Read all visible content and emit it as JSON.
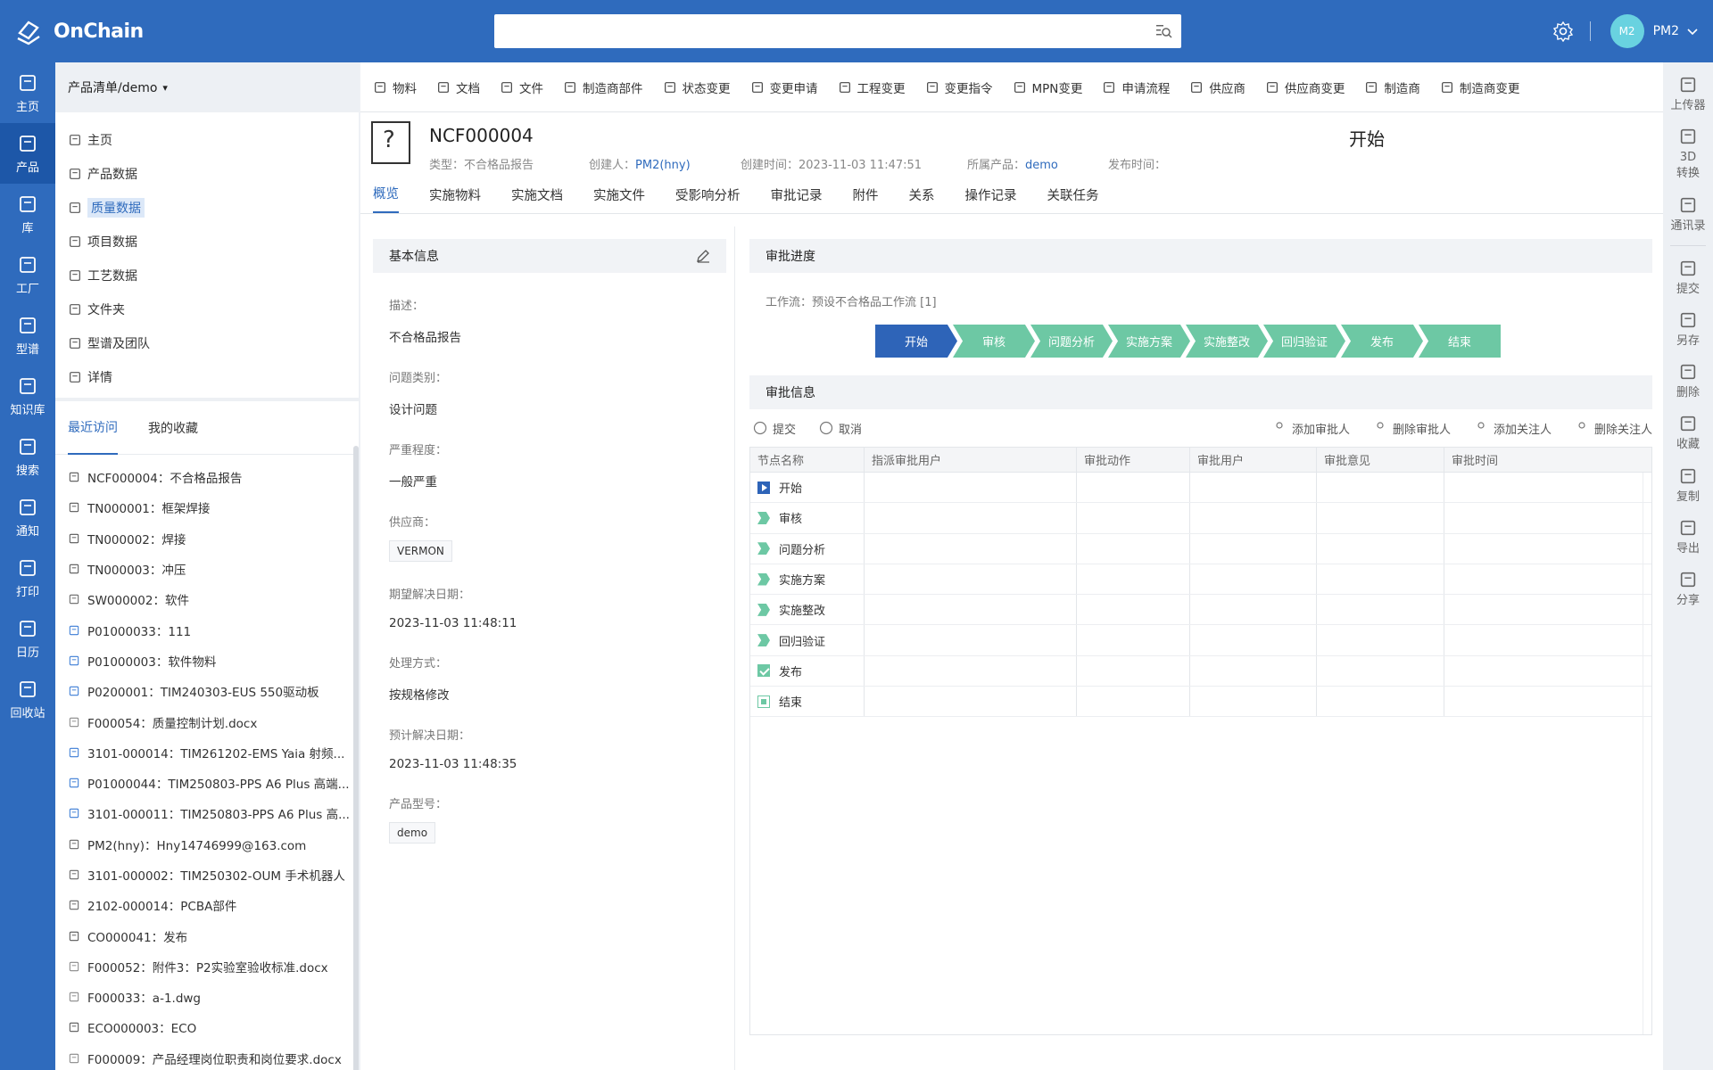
{
  "app": {
    "logo": "OnChain"
  },
  "search": {
    "placeholder": ""
  },
  "user": {
    "avatar": "M2",
    "name": "PM2"
  },
  "leftnav": [
    {
      "label": "主页",
      "icon": "home-icon"
    },
    {
      "label": "产品",
      "icon": "product-icon"
    },
    {
      "label": "库",
      "icon": "library-icon"
    },
    {
      "label": "工厂",
      "icon": "factory-icon"
    },
    {
      "label": "型谱",
      "icon": "spectrum-icon"
    },
    {
      "label": "知识库",
      "icon": "knowledge-icon"
    },
    {
      "label": "搜索",
      "icon": "search-doc-icon"
    },
    {
      "label": "通知",
      "icon": "mail-icon"
    },
    {
      "label": "打印",
      "icon": "print-icon"
    },
    {
      "label": "日历",
      "icon": "calendar-icon"
    },
    {
      "label": "回收站",
      "icon": "trash-icon"
    }
  ],
  "tree": {
    "header": "产品清单/demo",
    "items": [
      {
        "label": "主页",
        "icon": "monitor-icon"
      },
      {
        "label": "产品数据",
        "icon": "grid-icon"
      },
      {
        "label": "质量数据",
        "icon": "database-icon"
      },
      {
        "label": "项目数据",
        "icon": "bar-chart-icon"
      },
      {
        "label": "工艺数据",
        "icon": "flow-icon"
      },
      {
        "label": "文件夹",
        "icon": "folder-icon"
      },
      {
        "label": "型谱及团队",
        "icon": "tree-icon"
      },
      {
        "label": "详情",
        "icon": "list-icon"
      }
    ],
    "selected": "质量数据",
    "tabs": [
      "最近访问",
      "我的收藏"
    ],
    "recent": [
      {
        "label": "NCF000004：不合格品报告",
        "icon": "doc-icon"
      },
      {
        "label": "TN000001：框架焊接",
        "icon": "process-icon"
      },
      {
        "label": "TN000002：焊接",
        "icon": "process-icon"
      },
      {
        "label": "TN000003：冲压",
        "icon": "process-icon"
      },
      {
        "label": "SW000002：软件",
        "icon": "box-icon"
      },
      {
        "label": "P01000033：111",
        "icon": "cube-icon"
      },
      {
        "label": "P01000003：软件物料",
        "icon": "cube-icon"
      },
      {
        "label": "P0200001：TIM240303-EUS 550驱动板",
        "icon": "cube-icon"
      },
      {
        "label": "F000054：质量控制计划.docx",
        "icon": "file-icon"
      },
      {
        "label": "3101-000014：TIM261202-EMS Yaia 射频...",
        "icon": "cube-icon"
      },
      {
        "label": "P01000044：TIM250803-PPS A6 Plus 高端...",
        "icon": "cube-icon"
      },
      {
        "label": "3101-000011：TIM250803-PPS A6 Plus 高...",
        "icon": "cube-icon"
      },
      {
        "label": "PM2(hny)：Hny14746999@163.com",
        "icon": "user-icon"
      },
      {
        "label": "3101-000002：TIM250302-OUM 手术机器人",
        "icon": "box-icon"
      },
      {
        "label": "2102-000014：PCBA部件",
        "icon": "box-icon"
      },
      {
        "label": "CO000041：发布",
        "icon": "doc-icon"
      },
      {
        "label": "F000052：附件3：P2实验室验收标准.docx",
        "icon": "file-icon"
      },
      {
        "label": "F000033：a-1.dwg",
        "icon": "file-icon"
      },
      {
        "label": "ECO000003：ECO",
        "icon": "doc-icon"
      },
      {
        "label": "F000009：产品经理岗位职责和岗位要求.docx",
        "icon": "file-icon"
      }
    ]
  },
  "toolbar": [
    {
      "label": "物料",
      "icon": "cube-icon"
    },
    {
      "label": "文档",
      "icon": "doc-icon"
    },
    {
      "label": "文件",
      "icon": "file-icon"
    },
    {
      "label": "制造商部件",
      "icon": "building-icon"
    },
    {
      "label": "状态变更",
      "icon": "state-icon"
    },
    {
      "label": "变更申请",
      "icon": "doc-icon"
    },
    {
      "label": "工程变更",
      "icon": "doc-icon"
    },
    {
      "label": "变更指令",
      "icon": "doc-icon"
    },
    {
      "label": "MPN变更",
      "icon": "doc-icon"
    },
    {
      "label": "申请流程",
      "icon": "doc-plus-icon"
    },
    {
      "label": "供应商",
      "icon": "truck-icon"
    },
    {
      "label": "供应商变更",
      "icon": "truck-icon"
    },
    {
      "label": "制造商",
      "icon": "building-icon"
    },
    {
      "label": "制造商变更",
      "icon": "building-icon"
    }
  ],
  "record": {
    "title": "NCF000004",
    "type": "类型：不合格品报告",
    "creator_prefix": "创建人：",
    "creator": "PM2(hny)",
    "created": "创建时间：2023-11-03 11:47:51",
    "product_prefix": "所属产品：",
    "product": "demo",
    "published": "发布时间：",
    "state": "开始"
  },
  "tabs": [
    "概览",
    "实施物料",
    "实施文档",
    "实施文件",
    "受影响分析",
    "审批记录",
    "附件",
    "关系",
    "操作记录",
    "关联任务"
  ],
  "basic": {
    "title": "基本信息",
    "fields": [
      {
        "label": "描述：",
        "value": "不合格品报告"
      },
      {
        "label": "问题类别：",
        "value": "设计问题"
      },
      {
        "label": "严重程度：",
        "value": "一般严重"
      },
      {
        "label": "供应商：",
        "value": "VERMON",
        "tag": true
      },
      {
        "label": "期望解决日期：",
        "value": "2023-11-03 11:48:11"
      },
      {
        "label": "处理方式：",
        "value": "按规格修改"
      },
      {
        "label": "预计解决日期：",
        "value": "2023-11-03 11:48:35"
      },
      {
        "label": "产品型号：",
        "value": "demo",
        "tag": true
      }
    ]
  },
  "progress": {
    "title": "审批进度",
    "workflow": "工作流：预设不合格品工作流 [1]",
    "steps": [
      "开始",
      "审核",
      "问题分析",
      "实施方案",
      "实施整改",
      "回归验证",
      "发布",
      "结束"
    ]
  },
  "approval": {
    "title": "审批信息",
    "actions_left": [
      {
        "label": "提交",
        "icon": "up-circle-icon"
      },
      {
        "label": "取消",
        "icon": "x-circle-icon"
      }
    ],
    "actions_right": [
      {
        "label": "添加审批人",
        "icon": "user-icon"
      },
      {
        "label": "删除审批人",
        "icon": "user-icon"
      },
      {
        "label": "添加关注人",
        "icon": "user-icon"
      },
      {
        "label": "删除关注人",
        "icon": "user-icon"
      }
    ],
    "columns": [
      "节点名称",
      "指派审批用户",
      "审批动作",
      "审批用户",
      "审批意见",
      "审批时间"
    ],
    "rows": [
      {
        "node": "开始",
        "icon": "play"
      },
      {
        "node": "审核",
        "icon": "chevg"
      },
      {
        "node": "问题分析",
        "icon": "chevg"
      },
      {
        "node": "实施方案",
        "icon": "chevg"
      },
      {
        "node": "实施整改",
        "icon": "chevg"
      },
      {
        "node": "回归验证",
        "icon": "chevg"
      },
      {
        "node": "发布",
        "icon": "check"
      },
      {
        "node": "结束",
        "icon": "endsq"
      }
    ]
  },
  "rail": [
    {
      "label": "上传器",
      "icon": "upload-box-icon"
    },
    {
      "label": "3D\n转换",
      "icon": "cube-3d-icon"
    },
    {
      "label": "通讯录",
      "icon": "chat-icon"
    },
    {
      "label": "提交",
      "icon": "up-circle-icon"
    },
    {
      "label": "另存",
      "icon": "save-icon"
    },
    {
      "label": "删除",
      "icon": "trash-icon"
    },
    {
      "label": "收藏",
      "icon": "bookmark-icon"
    },
    {
      "label": "复制",
      "icon": "copy-icon"
    },
    {
      "label": "导出",
      "icon": "export-icon"
    },
    {
      "label": "分享",
      "icon": "share-icon"
    }
  ],
  "colors": {
    "brand": "#2f6bbd",
    "step_active": "#2e64b8",
    "step_pending": "#6dc8a4"
  }
}
